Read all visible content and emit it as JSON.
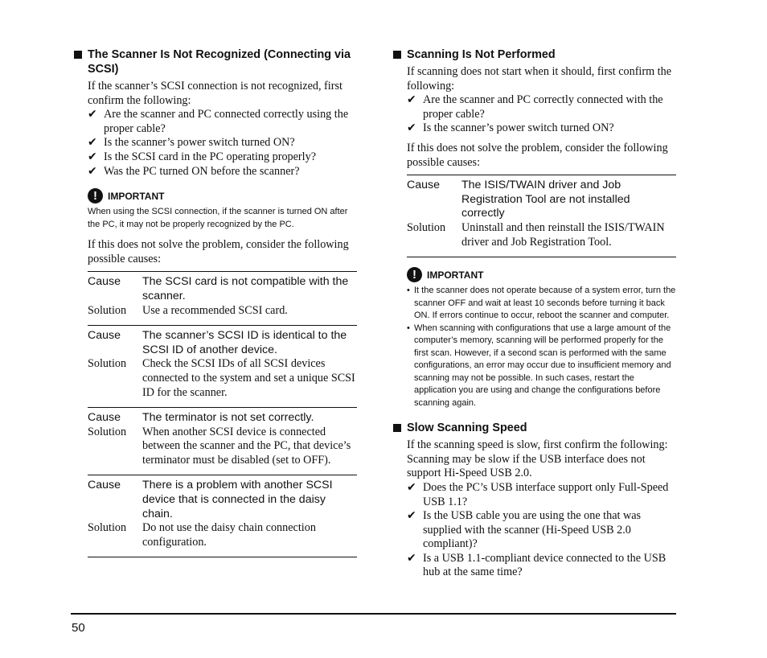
{
  "left": {
    "heading": "The Scanner Is Not Recognized (Connecting via SCSI)",
    "intro": "If the scanner’s SCSI connection is not recognized, first confirm the following:",
    "checklist": [
      "Are the scanner and PC connected correctly using the proper cable?",
      "Is the scanner’s power switch turned ON?",
      "Is the SCSI card in the PC operating properly?",
      "Was the PC turned ON before the scanner?"
    ],
    "important": {
      "label": "IMPORTANT",
      "text": "When using the SCSI connection, if the scanner is turned ON after the PC, it may not be properly recognized by the PC."
    },
    "after_text": "If this does not solve the problem, consider the following possible causes:",
    "table": [
      {
        "cause_label": "Cause",
        "cause": "The SCSI card is not compatible with the scanner.",
        "solution_label": "Solution",
        "solution": "Use a recommended SCSI card."
      },
      {
        "cause_label": "Cause",
        "cause": "The scanner’s SCSI ID is identical to the SCSI ID of another device.",
        "solution_label": "Solution",
        "solution": "Check the SCSI IDs of all SCSI devices connected to the system and set a unique SCSI ID for the scanner."
      },
      {
        "cause_label": "Cause",
        "cause": "The terminator is not set correctly.",
        "solution_label": "Solution",
        "solution": "When another SCSI device is connected between the scanner and the PC, that device’s terminator must be disabled (set to OFF)."
      },
      {
        "cause_label": "Cause",
        "cause": "There is a problem with another SCSI device that is connected in the daisy chain.",
        "solution_label": "Solution",
        "solution": "Do not use the daisy chain connection configuration."
      }
    ]
  },
  "right": {
    "section1": {
      "heading": "Scanning Is Not Performed",
      "intro": "If scanning does not start when it should, first confirm the following:",
      "checklist": [
        "Are the scanner and PC correctly connected with the proper cable?",
        "Is the scanner’s power switch turned ON?"
      ],
      "after_text": "If this does not solve the problem, consider the following possible causes:",
      "table": [
        {
          "cause_label": "Cause",
          "cause": "The ISIS/TWAIN driver and Job Registration Tool are not installed correctly",
          "solution_label": "Solution",
          "solution": "Uninstall and then reinstall the ISIS/TWAIN driver and Job Registration Tool."
        }
      ],
      "important": {
        "label": "IMPORTANT",
        "bullets": [
          "It the scanner does not operate because of a system error, turn the scanner OFF and wait at least 10 seconds before turning it back ON. If errors continue to occur, reboot the scanner and computer.",
          "When scanning with configurations that use a large amount of the computer’s memory, scanning will be performed properly for the first scan. However, if a second scan is performed with the same configurations, an error may occur due to insufficient memory and scanning may not be possible. In such cases, restart the application you are using and change the configurations before scanning again."
        ]
      }
    },
    "section2": {
      "heading": "Slow Scanning Speed",
      "intro": "If the scanning speed is slow, first confirm the following:",
      "intro2": "Scanning may be slow if the USB interface does not support Hi-Speed USB 2.0.",
      "checklist": [
        "Does the PC’s USB interface support only Full-Speed USB 1.1?",
        "Is the USB cable you are using the one that was supplied with the scanner (Hi-Speed USB 2.0 compliant)?",
        "Is a USB 1.1-compliant device connected to the USB hub at the same time?"
      ]
    }
  },
  "icons": {
    "check": "✔",
    "important": "!",
    "bullet": "•"
  },
  "footer": {
    "page_number": "50"
  }
}
